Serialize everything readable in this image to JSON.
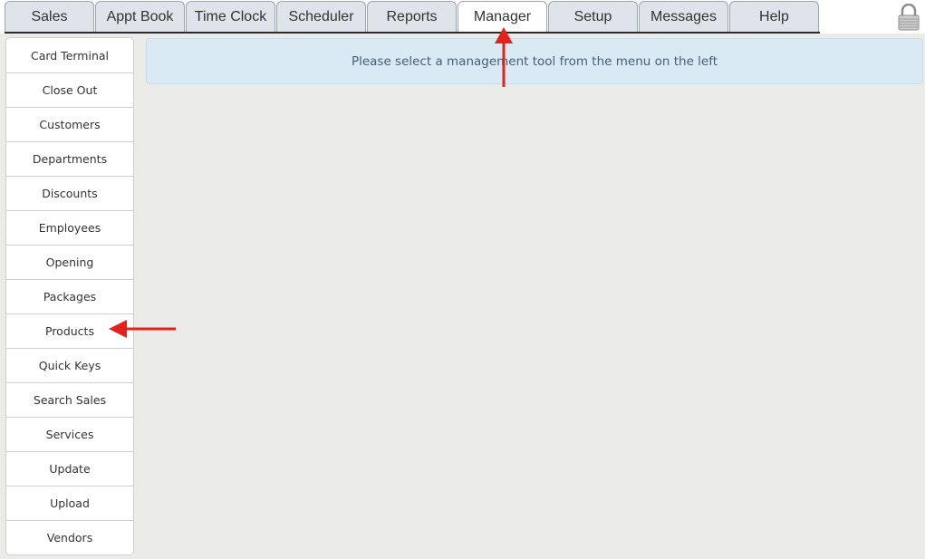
{
  "nav": {
    "tabs": [
      {
        "label": "Sales"
      },
      {
        "label": "Appt Book"
      },
      {
        "label": "Time Clock"
      },
      {
        "label": "Scheduler"
      },
      {
        "label": "Reports"
      },
      {
        "label": "Manager",
        "active": true
      },
      {
        "label": "Setup"
      },
      {
        "label": "Messages"
      },
      {
        "label": "Help"
      }
    ],
    "lock_icon": "lock-icon"
  },
  "sidebar": {
    "items": [
      {
        "label": "Card Terminal"
      },
      {
        "label": "Close Out"
      },
      {
        "label": "Customers"
      },
      {
        "label": "Departments"
      },
      {
        "label": "Discounts"
      },
      {
        "label": "Employees"
      },
      {
        "label": "Opening"
      },
      {
        "label": "Packages"
      },
      {
        "label": "Products"
      },
      {
        "label": "Quick Keys"
      },
      {
        "label": "Search Sales"
      },
      {
        "label": "Services"
      },
      {
        "label": "Update"
      },
      {
        "label": "Upload"
      },
      {
        "label": "Vendors"
      }
    ]
  },
  "main": {
    "notice": "Please select a management tool from the menu on the left"
  },
  "annotations": {
    "arrow_color": "#e3231b"
  }
}
